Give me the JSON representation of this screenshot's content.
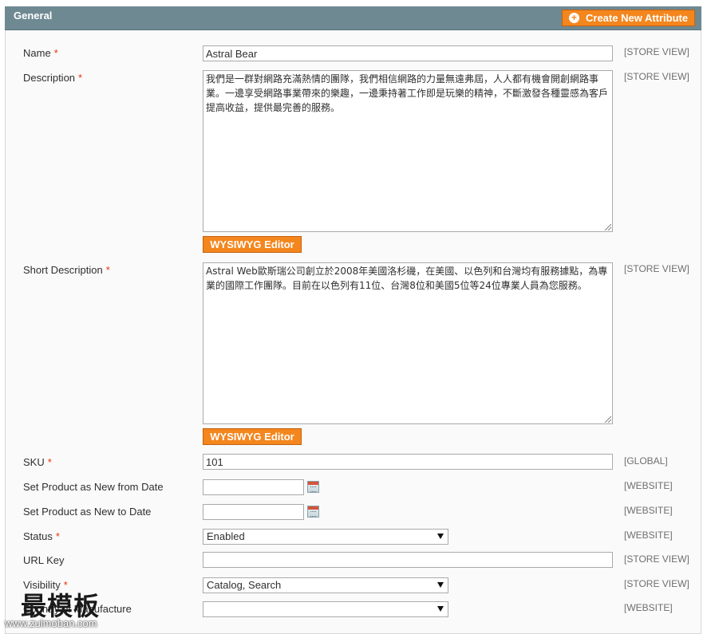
{
  "panel": {
    "title": "General",
    "create_label": "Create New Attribute"
  },
  "wysiwyg_label": "WYSIWYG Editor",
  "fields": {
    "name": {
      "label": "Name",
      "required": "*",
      "value": "Astral Bear",
      "scope": "[STORE VIEW]"
    },
    "description": {
      "label": "Description",
      "required": "*",
      "scope": "[STORE VIEW]",
      "value": "我們是一群對網路充滿熱情的團隊，我們相信網路的力量無遠弗屆，人人都有機會開創網路事業。一邊享受網路事業帶來的樂趣，一邊秉持著工作即是玩樂的精神，不斷激發各種靈感為客戶提高收益，提供最完善的服務。"
    },
    "short_description": {
      "label": "Short Description",
      "required": "*",
      "scope": "[STORE VIEW]",
      "value": "Astral Web歐斯瑞公司創立於2008年美國洛杉磯，在美國、以色列和台灣均有服務據點，為專業的國際工作團隊。目前在以色列有11位、台灣8位和美國5位等24位專業人員為您服務。"
    },
    "sku": {
      "label": "SKU",
      "required": "*",
      "value": "101",
      "scope": "[GLOBAL]"
    },
    "new_from": {
      "label": "Set Product as New from Date",
      "value": "",
      "scope": "[WEBSITE]"
    },
    "new_to": {
      "label": "Set Product as New to Date",
      "value": "",
      "scope": "[WEBSITE]"
    },
    "status": {
      "label": "Status",
      "required": "*",
      "value": "Enabled",
      "scope": "[WEBSITE]"
    },
    "url_key": {
      "label": "URL Key",
      "value": "",
      "scope": "[STORE VIEW]"
    },
    "visibility": {
      "label": "Visibility",
      "required": "*",
      "value": "Catalog, Search",
      "scope": "[STORE VIEW]"
    },
    "manufacture": {
      "label": "Country of Manufacture",
      "value": "",
      "scope": "[WEBSITE]"
    }
  },
  "watermark": {
    "text": "最模板",
    "url": "www.zuimoban.com"
  }
}
